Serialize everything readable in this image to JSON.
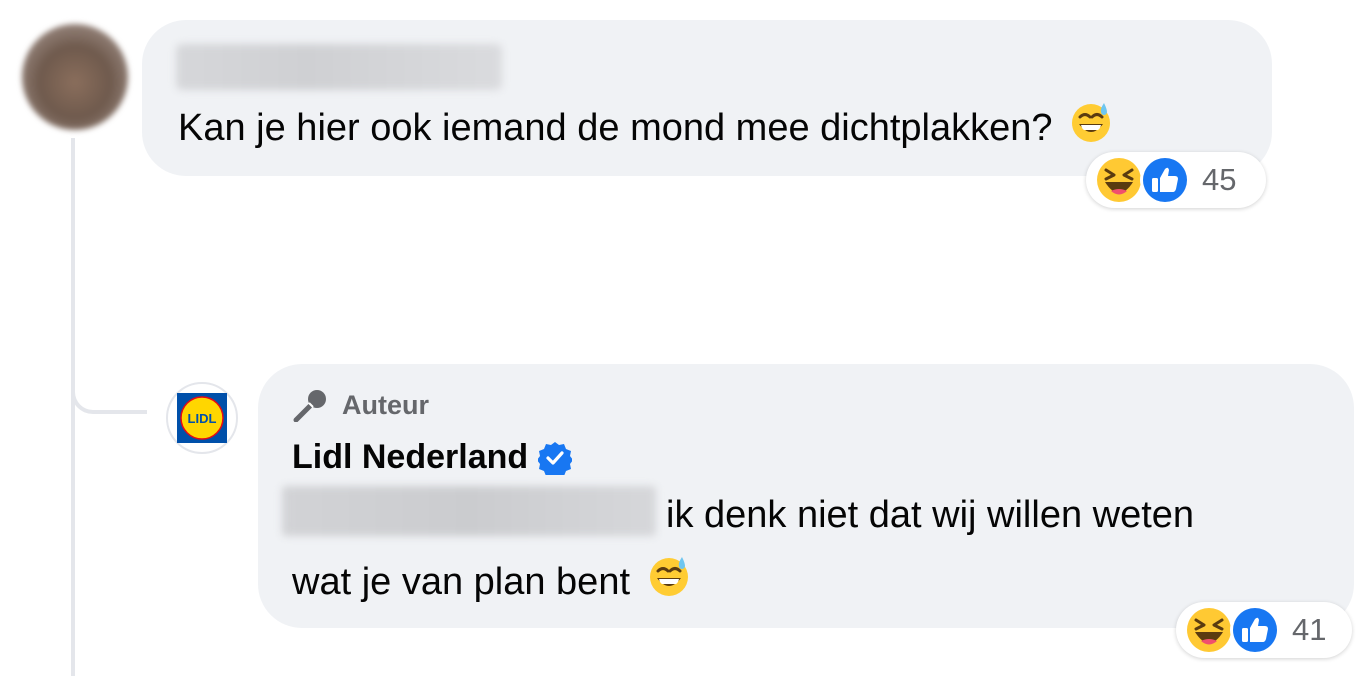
{
  "comments": [
    {
      "author_hidden": true,
      "text": "Kan je hier ook iemand de mond mee dichtplakken?",
      "emoji": "grinning-sweat-emoji",
      "reactions": {
        "types": [
          "haha",
          "like"
        ],
        "count": "45"
      }
    },
    {
      "badge": "Auteur",
      "author": "Lidl Nederland",
      "verified": true,
      "mention_hidden": true,
      "text_line1": "ik denk niet dat wij willen weten",
      "text_line2": "wat je van plan bent",
      "emoji": "grinning-sweat-emoji",
      "reactions": {
        "types": [
          "haha",
          "like"
        ],
        "count": "41"
      }
    }
  ],
  "colors": {
    "bubble": "#f0f2f5",
    "text": "#050505",
    "secondary_text": "#65676b",
    "like_blue": "#1877f2",
    "verified_blue": "#1877f2",
    "lidl_yellow": "#ffd600",
    "lidl_blue": "#0050aa",
    "lidl_red": "#e60a14"
  }
}
